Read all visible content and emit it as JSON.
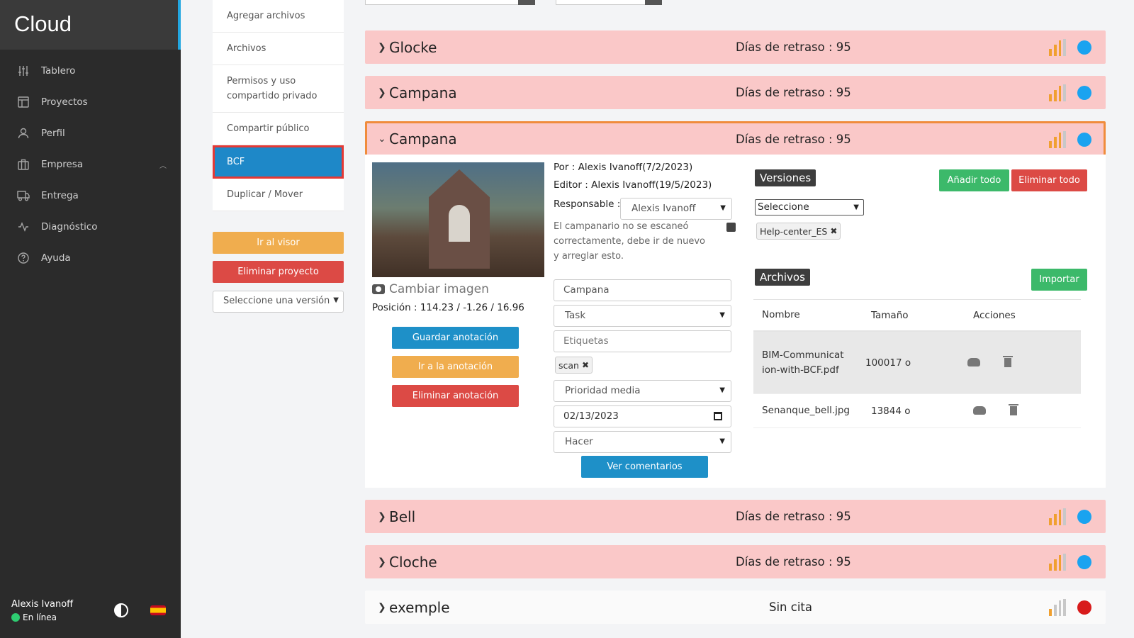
{
  "app": {
    "brand": "Cloud"
  },
  "sidebar": {
    "items": [
      {
        "label": "Tablero",
        "icon": "sliders-icon"
      },
      {
        "label": "Proyectos",
        "icon": "layout-icon"
      },
      {
        "label": "Perfil",
        "icon": "user-icon"
      },
      {
        "label": "Empresa",
        "icon": "briefcase-icon",
        "expanded": true
      },
      {
        "label": "Entrega",
        "icon": "truck-icon"
      },
      {
        "label": "Diagnóstico",
        "icon": "activity-icon"
      },
      {
        "label": "Ayuda",
        "icon": "help-circle-icon"
      }
    ],
    "user": {
      "name": "Alexis Ivanoff",
      "status": "En línea"
    }
  },
  "submenu": {
    "items": [
      "Agregar archivos",
      "Archivos",
      "Permisos y uso compartido privado",
      "Compartir público",
      "BCF",
      "Duplicar / Mover"
    ],
    "active": "BCF",
    "go_viewer": "Ir al visor",
    "delete_project": "Eliminar proyecto",
    "version_select": "Seleccione una versión"
  },
  "topics": [
    {
      "title": "Glocke",
      "delay": "Días de retraso : 95",
      "status_color": "#1aa3f0"
    },
    {
      "title": "Campana",
      "delay": "Días de retraso : 95",
      "status_color": "#1aa3f0"
    },
    {
      "title": "Campana",
      "delay": "Días de retraso : 95",
      "status_color": "#1aa3f0",
      "expanded": true
    },
    {
      "title": "Bell",
      "delay": "Días de retraso : 95",
      "status_color": "#1aa3f0"
    },
    {
      "title": "Cloche",
      "delay": "Días de retraso : 95",
      "status_color": "#1aa3f0"
    },
    {
      "title": "exemple",
      "delay": "Sin cita",
      "status_color": "#d81b1b"
    }
  ],
  "detail": {
    "change_image": "Cambiar imagen",
    "position": "Posición : 114.23 / -1.26 / 16.96",
    "save_annotation": "Guardar anotación",
    "go_annotation": "Ir a la anotación",
    "delete_annotation": "Eliminar anotación",
    "author": "Por : Alexis Ivanoff(7/2/2023)",
    "editor": "Editor : Alexis Ivanoff(19/5/2023)",
    "responsible_label": "Responsable :",
    "responsible_value": "Alexis Ivanoff",
    "description": "El campanario no se escaneó correctamente, debe ir de nuevo y arreglar esto.",
    "title_value": "Campana",
    "type_value": "Task",
    "labels_placeholder": "Etiquetas",
    "tag": "scan",
    "priority_value": "Prioridad media",
    "date_value": "02/13/2023",
    "status_value": "Hacer",
    "comments_button": "Ver comentarios",
    "versions_title": "Versiones",
    "add_all": "Añadir todo",
    "remove_all": "Eliminar todo",
    "versions_select": "Seleccione",
    "version_tag": "Help-center_ES",
    "files_title": "Archivos",
    "import": "Importar",
    "columns": [
      "Nombre",
      "Tamaño",
      "Acciones"
    ],
    "files": [
      {
        "name": "BIM-Communication-with-BCF.pdf",
        "size": "100017 o"
      },
      {
        "name": "Senanque_bell.jpg",
        "size": "13844 o"
      }
    ]
  },
  "colors": {
    "row_pink": "#fac8c8",
    "accent_blue": "#1e88c8",
    "bars_orange": "#f0a030",
    "bars_gray": "#c8c8c8"
  }
}
